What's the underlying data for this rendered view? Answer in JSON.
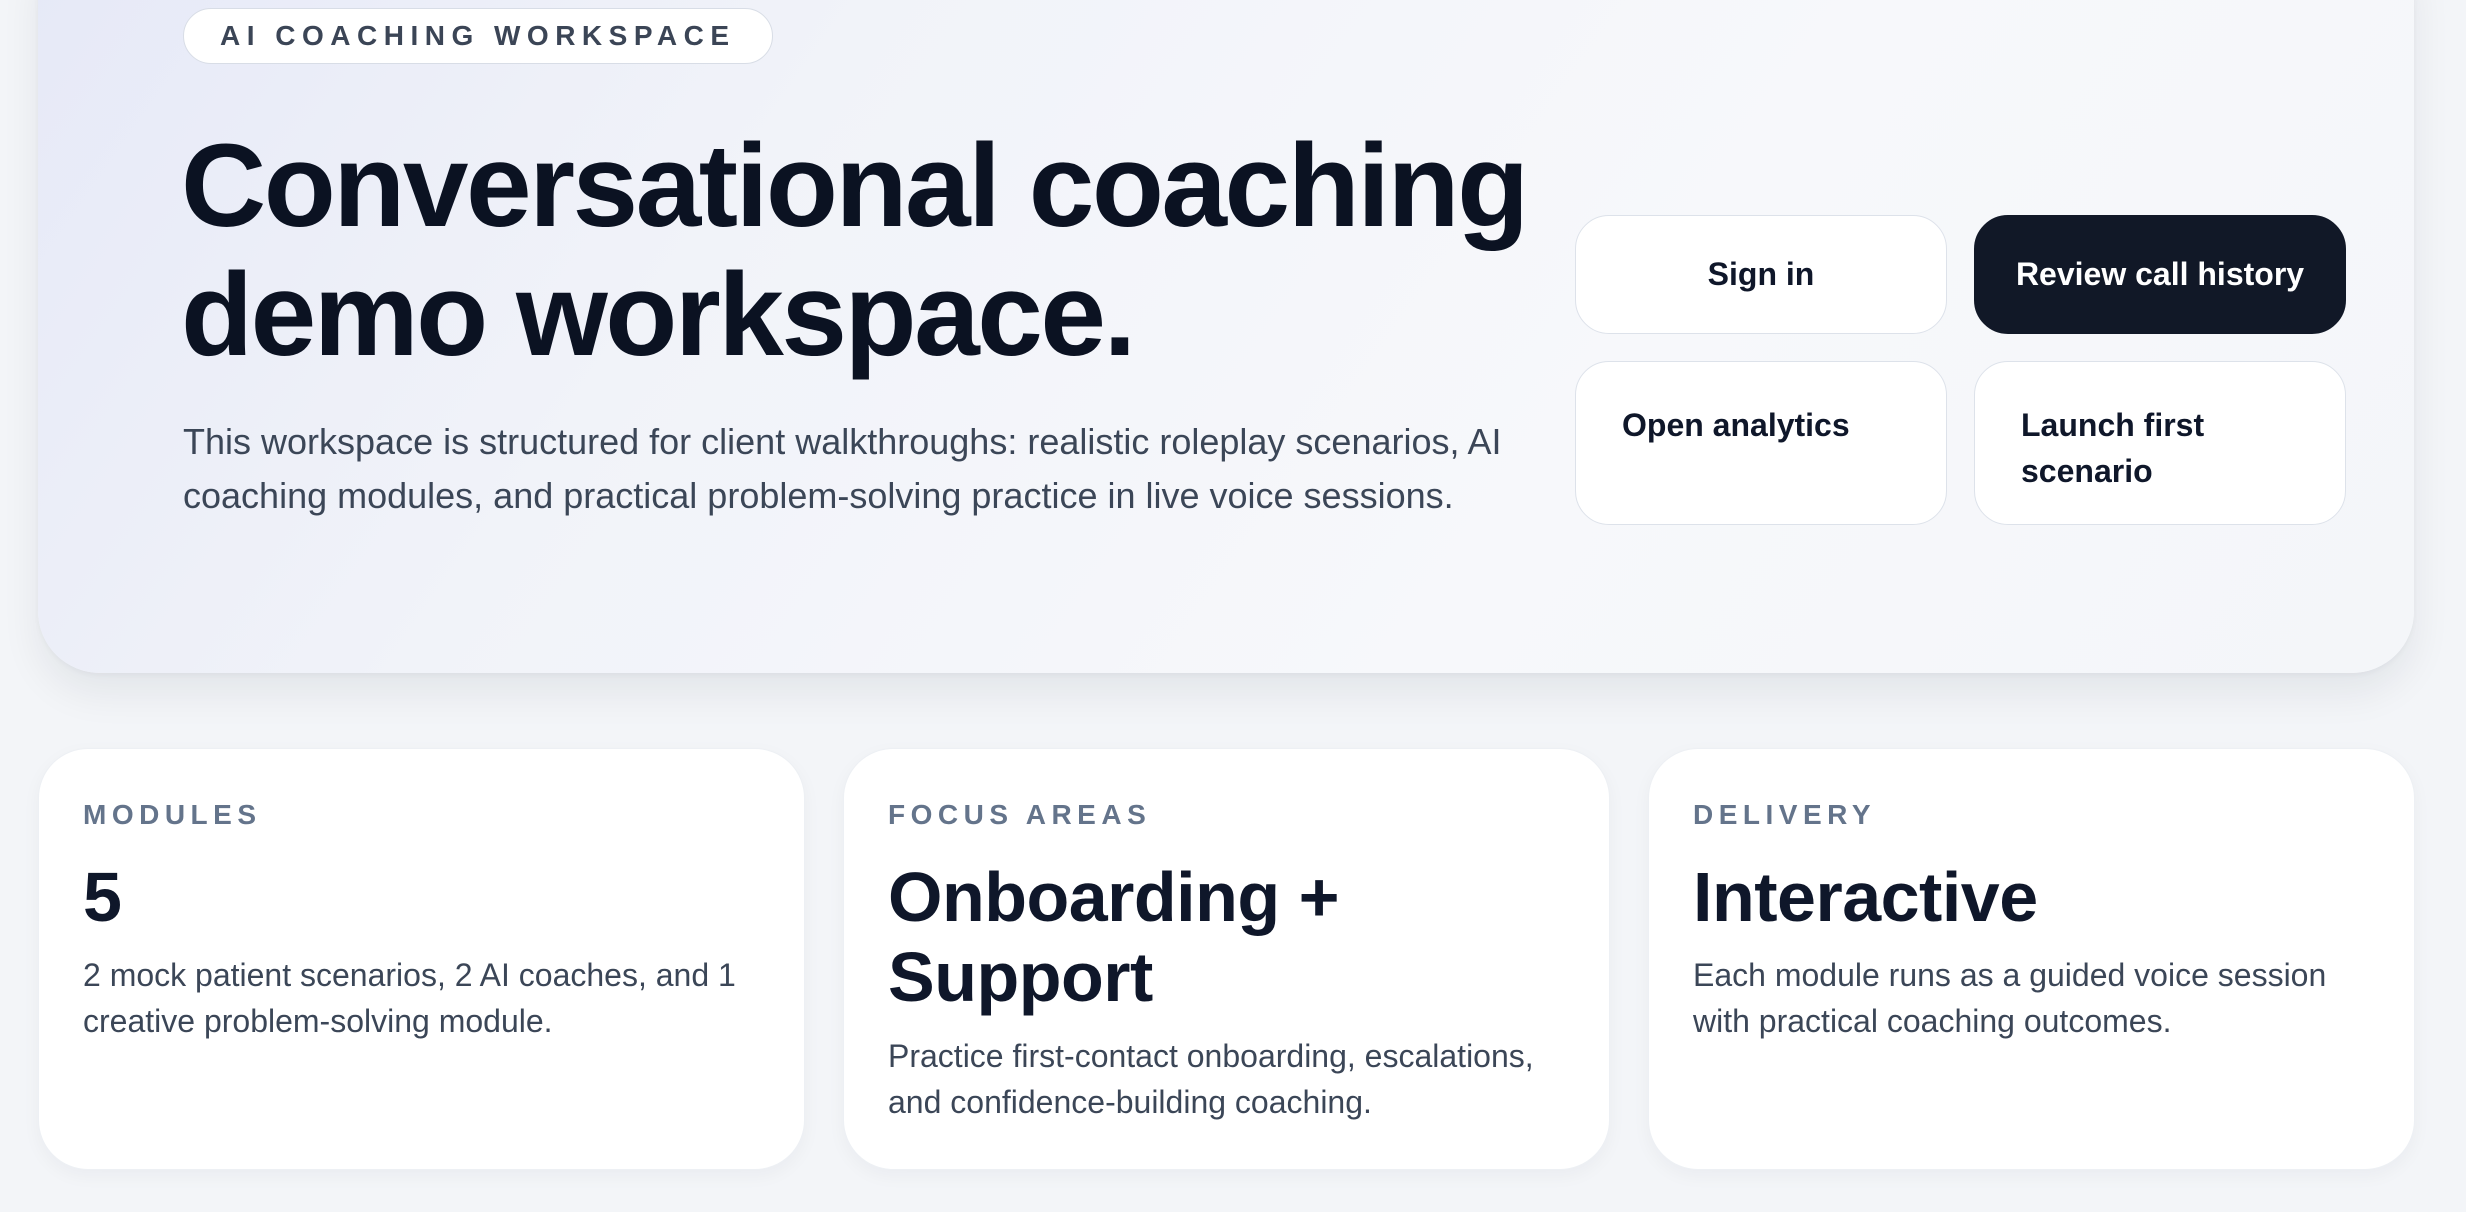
{
  "hero": {
    "badge": "AI COACHING WORKSPACE",
    "title": "Conversational coaching demo workspace.",
    "description": "This workspace is structured for client walkthroughs: realistic roleplay scenarios, AI coaching modules, and practical problem-solving practice in live voice sessions.",
    "actions": {
      "sign_in": "Sign in",
      "review_history": "Review call history",
      "open_analytics": "Open analytics",
      "launch_scenario": "Launch first scenario"
    }
  },
  "stats": [
    {
      "label": "MODULES",
      "value": "5",
      "description": "2 mock patient scenarios, 2 AI coaches, and 1 creative problem-solving module."
    },
    {
      "label": "FOCUS AREAS",
      "value": "Onboarding + Support",
      "description": "Practice first-contact onboarding, escalations, and confidence-building coaching."
    },
    {
      "label": "DELIVERY",
      "value": "Interactive",
      "description": "Each module runs as a guided voice session with practical coaching outcomes."
    }
  ],
  "colors": {
    "primary_button": "#111827",
    "heading": "#0f172a",
    "muted_label": "#64748b"
  }
}
